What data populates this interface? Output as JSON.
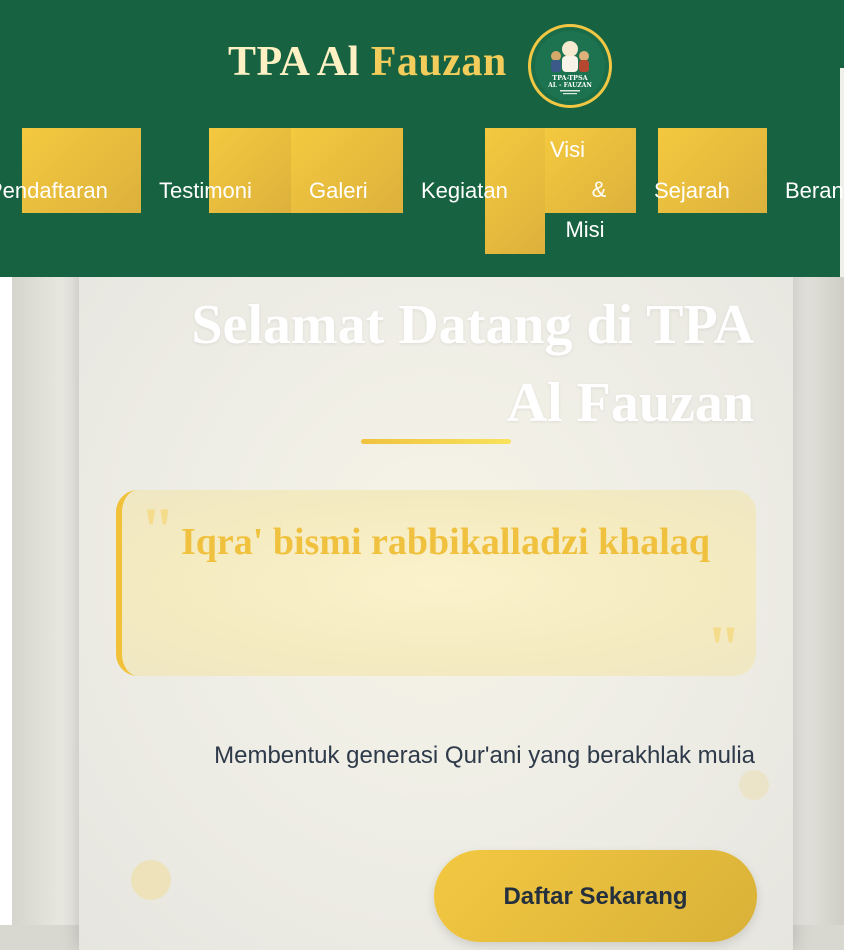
{
  "brand": {
    "name_part1": "TPA Al ",
    "name_part2": "Fauzan",
    "logo_text_top": "TPA-TPSA",
    "logo_text_mid": "AL - FAUZAN"
  },
  "nav": {
    "pendaftaran": "Pendaftaran",
    "testimoni": "Testimoni",
    "galeri": "Galeri",
    "kegiatan": "Kegiatan",
    "visi_line1": "Visi",
    "visi_line2": "&",
    "visi_line3": "Misi",
    "sejarah": "Sejarah",
    "beranda": "Beranda"
  },
  "hero": {
    "title": "Selamat Datang di TPA Al Fauzan",
    "quote": "Iqra' bismi rabbikalladzi khalaq",
    "tagline": "Membentuk generasi Qur'ani yang berakhlak mulia",
    "cta": "Daftar Sekarang"
  },
  "colors": {
    "header_green": "#176240",
    "accent_gold": "#f2c744",
    "text_dark": "#2e3a4a"
  }
}
